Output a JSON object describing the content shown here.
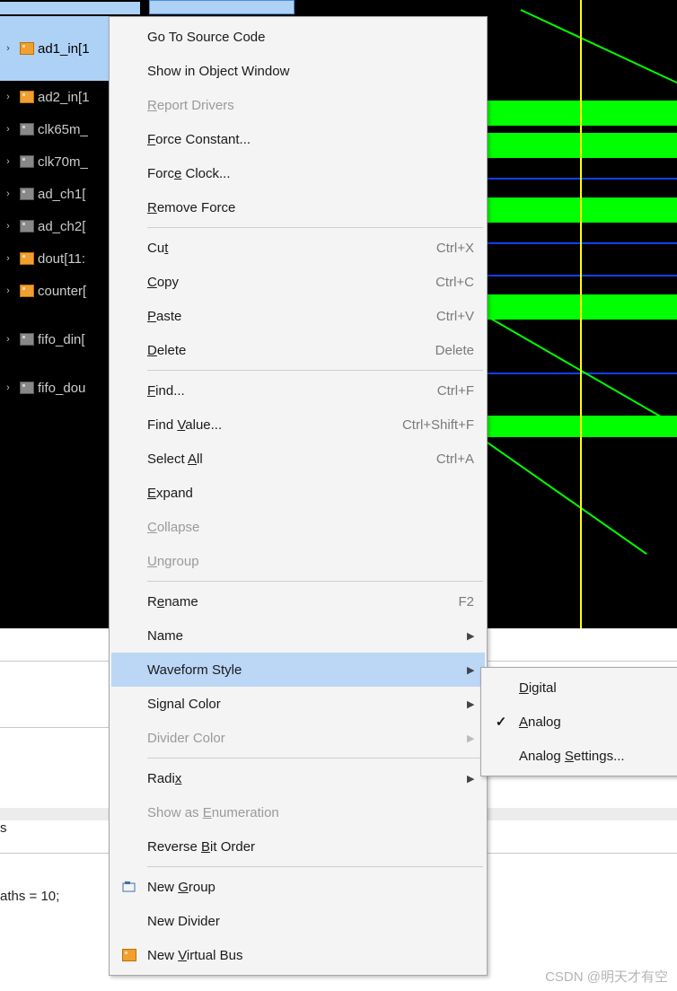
{
  "signals": {
    "s0": "ad1_in[1",
    "s1": "ad2_in[1",
    "s2": "clk65m_",
    "s3": "clk70m_",
    "s4": "ad_ch1[",
    "s5": "ad_ch2[",
    "s6": "dout[11:",
    "s7": "counter[",
    "s8": "fifo_din[",
    "s9": "fifo_dou"
  },
  "menu": {
    "goto": "Go To Source Code",
    "show": "Show in Object Window",
    "report_pre": "",
    "report_u": "R",
    "report_post": "eport Drivers",
    "forceconst_pre": "",
    "forceconst_u": "F",
    "forceconst_post": "orce Constant...",
    "forceclk_pre": "Forc",
    "forceclk_u": "e",
    "forceclk_post": " Clock...",
    "remove_pre": "",
    "remove_u": "R",
    "remove_post": "emove Force",
    "cut_pre": "Cu",
    "cut_u": "t",
    "cut_post": "",
    "cut_sc": "Ctrl+X",
    "copy_pre": "",
    "copy_u": "C",
    "copy_post": "opy",
    "copy_sc": "Ctrl+C",
    "paste_pre": "",
    "paste_u": "P",
    "paste_post": "aste",
    "paste_sc": "Ctrl+V",
    "del_pre": "",
    "del_u": "D",
    "del_post": "elete",
    "del_sc": "Delete",
    "find_pre": "",
    "find_u": "F",
    "find_post": "ind...",
    "find_sc": "Ctrl+F",
    "findv_pre": "Find ",
    "findv_u": "V",
    "findv_post": "alue...",
    "findv_sc": "Ctrl+Shift+F",
    "selall_pre": "Select ",
    "selall_u": "A",
    "selall_post": "ll",
    "selall_sc": "Ctrl+A",
    "expand_pre": "",
    "expand_u": "E",
    "expand_post": "xpand",
    "collapse_pre": "",
    "collapse_u": "C",
    "collapse_post": "ollapse",
    "ungroup_pre": "",
    "ungroup_u": "U",
    "ungroup_post": "ngroup",
    "rename_pre": "R",
    "rename_u": "e",
    "rename_post": "name",
    "rename_sc": "F2",
    "name": "Name",
    "wstyle": "Waveform Style",
    "sigcolor": "Signal Color",
    "divcolor": "Divider Color",
    "radix_pre": "Radi",
    "radix_u": "x",
    "radix_post": "",
    "showenum_pre": "Show as ",
    "showenum_u": "E",
    "showenum_post": "numeration",
    "revbit_pre": "Reverse ",
    "revbit_u": "B",
    "revbit_post": "it Order",
    "newgrp_pre": "New ",
    "newgrp_u": "G",
    "newgrp_post": "roup",
    "newdiv": "New Divider",
    "newvbus_pre": "New ",
    "newvbus_u": "V",
    "newvbus_post": "irtual Bus"
  },
  "submenu": {
    "digital_pre": "",
    "digital_u": "D",
    "digital_post": "igital",
    "analog_pre": "",
    "analog_u": "A",
    "analog_post": "nalog",
    "asettings_pre": "Analog ",
    "asettings_u": "S",
    "asettings_post": "ettings..."
  },
  "lower": {
    "text1": "s",
    "text2": "aths = 10;"
  },
  "footer": "CSDN @明天才有空"
}
